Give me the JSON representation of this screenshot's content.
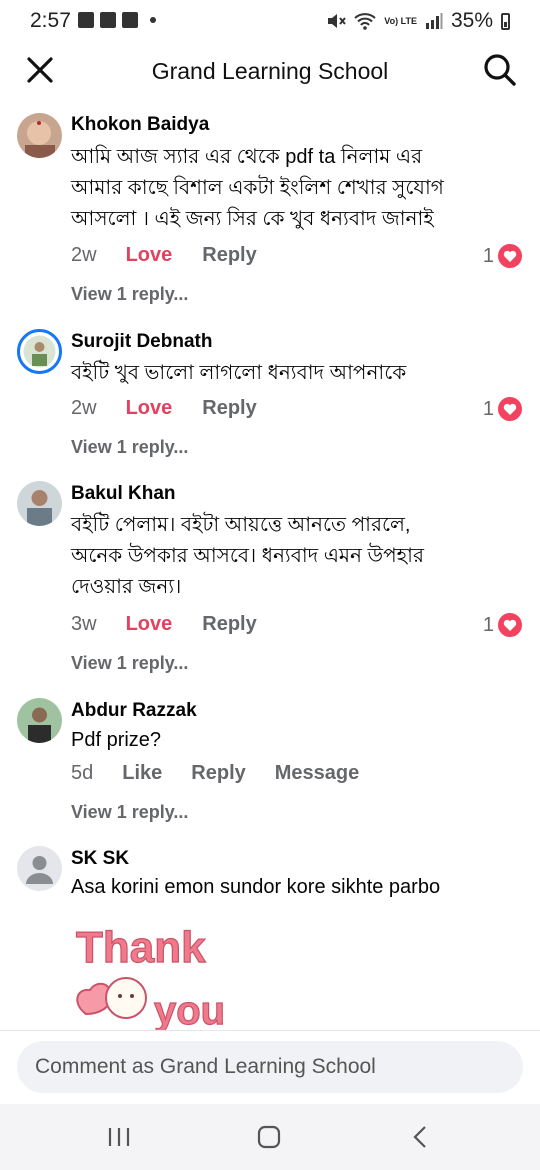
{
  "status_bar": {
    "time": "2:57",
    "battery": "35%",
    "network": "Vo) LTE"
  },
  "header": {
    "title": "Grand Learning School"
  },
  "comments": [
    {
      "name": "Khokon Baidya",
      "lines": [
        "আমি আজ স্যার এর থেকে pdf ta নিলাম এর",
        "আমার কাছে বিশাল একটা ইংলিশ শেখার সুযোগ",
        "আসলো । এই জন্য সির কে খুব ধন্যবাদ জানাই"
      ],
      "time": "2w",
      "action": "Love",
      "reply": "Reply",
      "reaction_count": "1",
      "view_replies": "View 1 reply..."
    },
    {
      "name": "Surojit Debnath",
      "lines": [
        "বইটি খুব ভালো লাগলো ধন্যবাদ আপনাকে"
      ],
      "time": "2w",
      "action": "Love",
      "reply": "Reply",
      "reaction_count": "1",
      "view_replies": "View 1 reply..."
    },
    {
      "name": "Bakul Khan",
      "lines": [
        "বইটি পেলাম। বইটা আয়ত্তে আনতে পারলে,",
        "অনেক উপকার আসবে। ধন্যবাদ এমন উপহার",
        "দেওয়ার জন্য।"
      ],
      "time": "3w",
      "action": "Love",
      "reply": "Reply",
      "reaction_count": "1",
      "view_replies": "View 1 reply..."
    },
    {
      "name": "Abdur Razzak",
      "lines": [
        "Pdf prize?"
      ],
      "time": "5d",
      "action": "Like",
      "reply": "Reply",
      "message": "Message",
      "view_replies": "View 1 reply..."
    },
    {
      "name": "SK SK",
      "lines": [
        "Asa korini emon sundor kore sikhte parbo"
      ],
      "sticker": {
        "line1": "Thank",
        "line2": "you"
      }
    }
  ],
  "composer": {
    "placeholder": "Comment as Grand Learning School"
  },
  "colors": {
    "love": "#e4405f",
    "heart": "#f3425f",
    "muted": "#65676b"
  },
  "icons": [
    "close-icon",
    "search-icon",
    "heart-reaction-icon",
    "recents-icon",
    "home-icon",
    "back-icon"
  ]
}
